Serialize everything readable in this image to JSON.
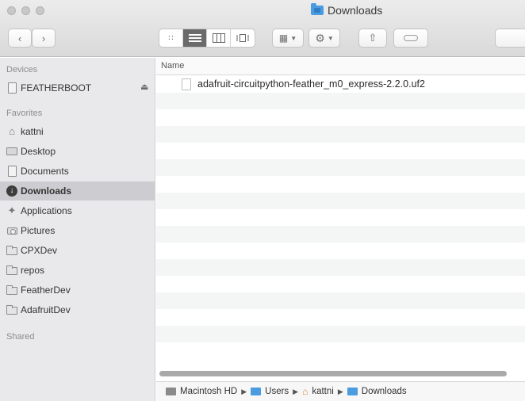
{
  "window": {
    "title": "Downloads"
  },
  "toolbar": {
    "back_icon": "chevron-left-icon",
    "forward_icon": "chevron-right-icon",
    "view_modes": [
      "icon-view-icon",
      "list-view-icon",
      "column-view-icon",
      "gallery-view-icon"
    ],
    "active_view": "list-view-icon"
  },
  "sidebar": {
    "devices_title": "Devices",
    "devices": [
      {
        "label": "FEATHERBOOT",
        "icon": "drive-icon"
      }
    ],
    "favorites_title": "Favorites",
    "favorites": [
      {
        "label": "kattni",
        "icon": "home-icon"
      },
      {
        "label": "Desktop",
        "icon": "desktop-icon"
      },
      {
        "label": "Documents",
        "icon": "documents-icon"
      },
      {
        "label": "Downloads",
        "icon": "downloads-icon"
      },
      {
        "label": "Applications",
        "icon": "applications-icon"
      },
      {
        "label": "Pictures",
        "icon": "camera-icon"
      },
      {
        "label": "CPXDev",
        "icon": "folder-icon"
      },
      {
        "label": "repos",
        "icon": "folder-icon"
      },
      {
        "label": "FeatherDev",
        "icon": "folder-icon"
      },
      {
        "label": "AdafruitDev",
        "icon": "folder-icon"
      }
    ],
    "selected": "Downloads",
    "shared_title": "Shared"
  },
  "content": {
    "column_name": "Name",
    "files": [
      {
        "name": "adafruit-circuitpython-feather_m0_express-2.2.0.uf2",
        "icon": "file-icon"
      }
    ]
  },
  "pathbar": {
    "segments": [
      "Macintosh HD",
      "Users",
      "kattni",
      "Downloads"
    ]
  },
  "colors": {
    "sidebar_bg": "#e9e9ec",
    "selection_bg": "#cdcdd1",
    "folder_blue": "#4a9be0",
    "stripe": "#f4f5f5"
  }
}
